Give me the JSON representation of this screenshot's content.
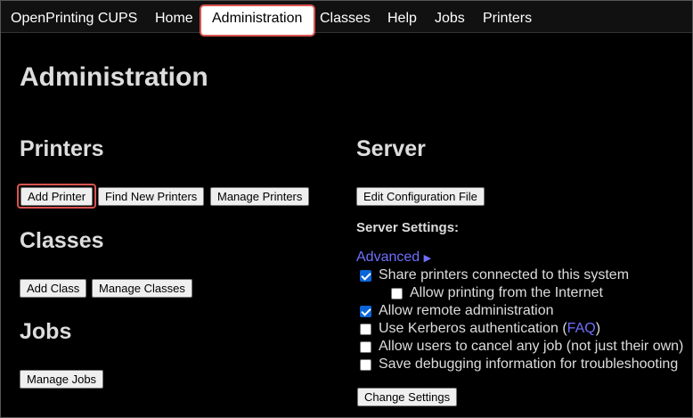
{
  "nav": {
    "brand": "OpenPrinting CUPS",
    "home": "Home",
    "administration": "Administration",
    "classes": "Classes",
    "help": "Help",
    "jobs": "Jobs",
    "printers": "Printers"
  },
  "page_title": "Administration",
  "printers": {
    "heading": "Printers",
    "add_printer": "Add Printer",
    "find_new_printers": "Find New Printers",
    "manage_printers": "Manage Printers"
  },
  "classes": {
    "heading": "Classes",
    "add_class": "Add Class",
    "manage_classes": "Manage Classes"
  },
  "jobs": {
    "heading": "Jobs",
    "manage_jobs": "Manage Jobs"
  },
  "server": {
    "heading": "Server",
    "edit_config": "Edit Configuration File",
    "settings_label": "Server Settings:",
    "advanced": "Advanced",
    "advanced_arrow": "▶",
    "share_printers": "Share printers connected to this system",
    "allow_internet": "Allow printing from the Internet",
    "allow_remote_admin": "Allow remote administration",
    "kerberos_prefix": "Use Kerberos authentication (",
    "kerberos_faq": "FAQ",
    "kerberos_suffix": ")",
    "cancel_any_job": "Allow users to cancel any job (not just their own)",
    "save_debug": "Save debugging information for troubleshooting",
    "change_settings": "Change Settings",
    "checks": {
      "share_printers": true,
      "allow_internet": false,
      "allow_remote_admin": true,
      "kerberos": false,
      "cancel_any_job": false,
      "save_debug": false
    }
  },
  "colors": {
    "highlight": "#d9534f",
    "link": "#6f6fff",
    "checkbox_on": "#0a66d8"
  }
}
